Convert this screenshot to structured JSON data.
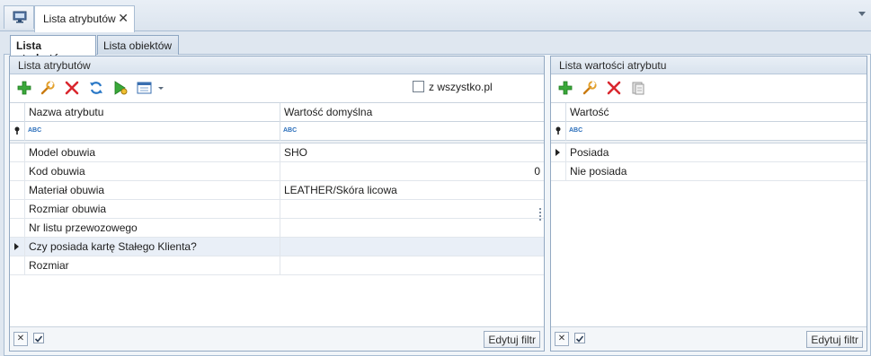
{
  "doc_tab": {
    "title": "Lista atrybutów",
    "close": "✕"
  },
  "subtabs": [
    {
      "label": "Lista atrybutów"
    },
    {
      "label": "Lista obiektów"
    }
  ],
  "left_panel": {
    "header": "Lista atrybutów",
    "checkbox_label": "z wszystko.pl",
    "columns": [
      "Nazwa atrybutu",
      "Wartość domyślna"
    ],
    "filter_icon_text": "ABC",
    "rows": [
      {
        "name": "Model obuwia",
        "value": "SHO",
        "value_align": "left"
      },
      {
        "name": "Kod obuwia",
        "value": "0",
        "value_align": "right"
      },
      {
        "name": "Materiał obuwia",
        "value": "LEATHER/Skóra licowa",
        "value_align": "left"
      },
      {
        "name": "Rozmiar obuwia",
        "value": "",
        "value_align": "left"
      },
      {
        "name": "Nr listu przewozowego",
        "value": "",
        "value_align": "left"
      },
      {
        "name": "Czy posiada kartę Stałego Klienta?",
        "value": "",
        "value_align": "left"
      },
      {
        "name": "Rozmiar",
        "value": "",
        "value_align": "left"
      }
    ],
    "selected_row": 5,
    "footer_button": "Edytuj filtr"
  },
  "right_panel": {
    "header": "Lista wartości atrybutu",
    "columns": [
      "Wartość"
    ],
    "filter_icon_text": "ABC",
    "rows": [
      {
        "value": "Posiada"
      },
      {
        "value": "Nie posiada"
      }
    ],
    "selected_row": 0,
    "footer_button": "Edytuj filtr"
  },
  "icons": {
    "add": "plus-icon",
    "edit": "wrench-icon",
    "delete": "delete-x-icon",
    "refresh": "refresh-icon",
    "run": "play-icon",
    "view": "view-options-icon",
    "copy": "copy-icon"
  },
  "colors": {
    "add_green": "#2f9e2f",
    "delete_red": "#d9272e",
    "edit_orange": "#e39a2b",
    "refresh_blue": "#2a78c6"
  }
}
